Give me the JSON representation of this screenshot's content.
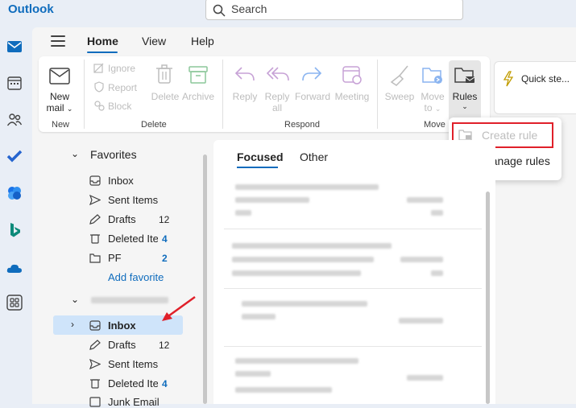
{
  "app": {
    "title": "Outlook"
  },
  "search": {
    "placeholder": "Search"
  },
  "nav_tabs": [
    "Home",
    "View",
    "Help"
  ],
  "ribbon": {
    "new_group": {
      "line1": "New",
      "line2": "mail",
      "label": "New"
    },
    "delete_group": {
      "ignore": "Ignore",
      "report": "Report",
      "block": "Block",
      "delete": "Delete",
      "archive": "Archive",
      "label": "Delete"
    },
    "respond_group": {
      "reply": "Reply",
      "reply_all_1": "Reply",
      "reply_all_2": "all",
      "forward": "Forward",
      "meeting": "Meeting",
      "label": "Respond"
    },
    "move_group": {
      "sweep": "Sweep",
      "move_to_1": "Move",
      "move_to_2": "to",
      "rules": "Rules",
      "label": "Move"
    },
    "quick_steps": "Quick ste..."
  },
  "rules_menu": {
    "create_rule": "Create rule",
    "manage_rules": "Manage rules"
  },
  "folders": {
    "favorites_label": "Favorites",
    "favorites": [
      {
        "name": "Inbox",
        "count": ""
      },
      {
        "name": "Sent Items",
        "count": ""
      },
      {
        "name": "Drafts",
        "count": "12"
      },
      {
        "name": "Deleted Iter",
        "count": "4"
      },
      {
        "name": "PF",
        "count": "2"
      }
    ],
    "add_favorite": "Add favorite",
    "account": [
      {
        "name": "Inbox",
        "count": ""
      },
      {
        "name": "Drafts",
        "count": "12"
      },
      {
        "name": "Sent Items",
        "count": ""
      },
      {
        "name": "Deleted Iter",
        "count": "4"
      },
      {
        "name": "Junk Email",
        "count": ""
      }
    ]
  },
  "message_list": {
    "tabs": [
      "Focused",
      "Other"
    ]
  },
  "colors": {
    "accent": "#0f6cbd",
    "highlight": "#e0202a",
    "selected_row": "#cfe4fa",
    "dim_icon": "#bdbdbd"
  }
}
